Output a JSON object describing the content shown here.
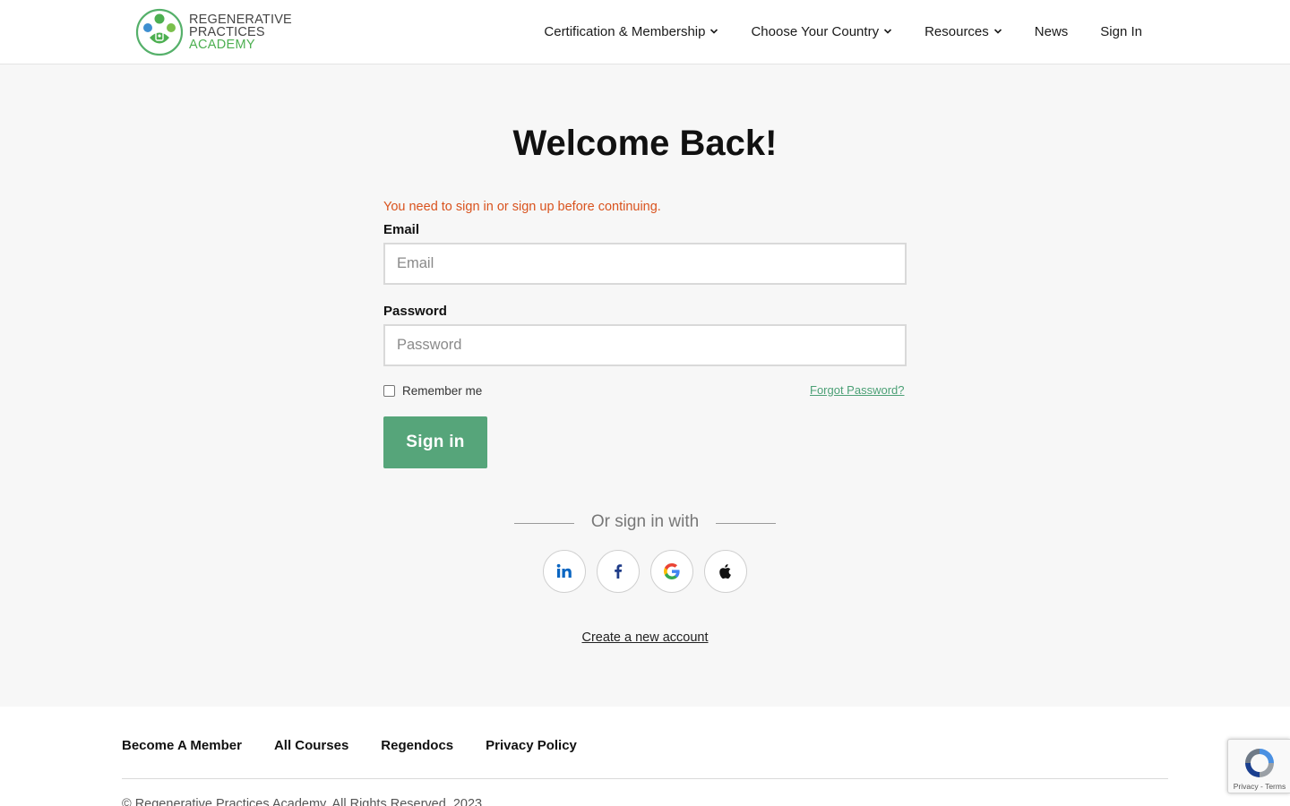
{
  "header": {
    "logo": {
      "line1": "REGENERATIVE",
      "line2": "PRACTICES",
      "line3": "ACADEMY"
    },
    "nav": [
      {
        "label": "Certification & Membership",
        "has_dropdown": true
      },
      {
        "label": "Choose Your Country",
        "has_dropdown": true
      },
      {
        "label": "Resources",
        "has_dropdown": true
      },
      {
        "label": "News",
        "has_dropdown": false
      },
      {
        "label": "Sign In",
        "has_dropdown": false
      }
    ]
  },
  "main": {
    "title": "Welcome Back!",
    "notice": "You need to sign in or sign up before continuing.",
    "email": {
      "label": "Email",
      "placeholder": "Email",
      "value": ""
    },
    "password": {
      "label": "Password",
      "placeholder": "Password",
      "value": ""
    },
    "remember_label": "Remember me",
    "remember_checked": false,
    "forgot_label": "Forgot Password?",
    "signin_label": "Sign in",
    "or_text": "Or sign in with",
    "social": [
      {
        "name": "linkedin-icon",
        "glyph": "in"
      },
      {
        "name": "facebook-icon",
        "glyph": "f"
      },
      {
        "name": "google-icon",
        "glyph": "G"
      },
      {
        "name": "apple-icon",
        "glyph": "apple"
      }
    ],
    "create_account": "Create a new account"
  },
  "footer": {
    "links": [
      "Become A Member",
      "All Courses",
      "Regendocs",
      "Privacy Policy"
    ],
    "copyright": "© Regenerative Practices Academy. All Rights Reserved. 2023"
  },
  "recaptcha": {
    "text": "Privacy - Terms"
  },
  "colors": {
    "accent": "#56a57a",
    "notice": "#d9531e",
    "link_green": "#4ca076",
    "logo_green": "#4caf50",
    "background": "#f7f7f7"
  }
}
